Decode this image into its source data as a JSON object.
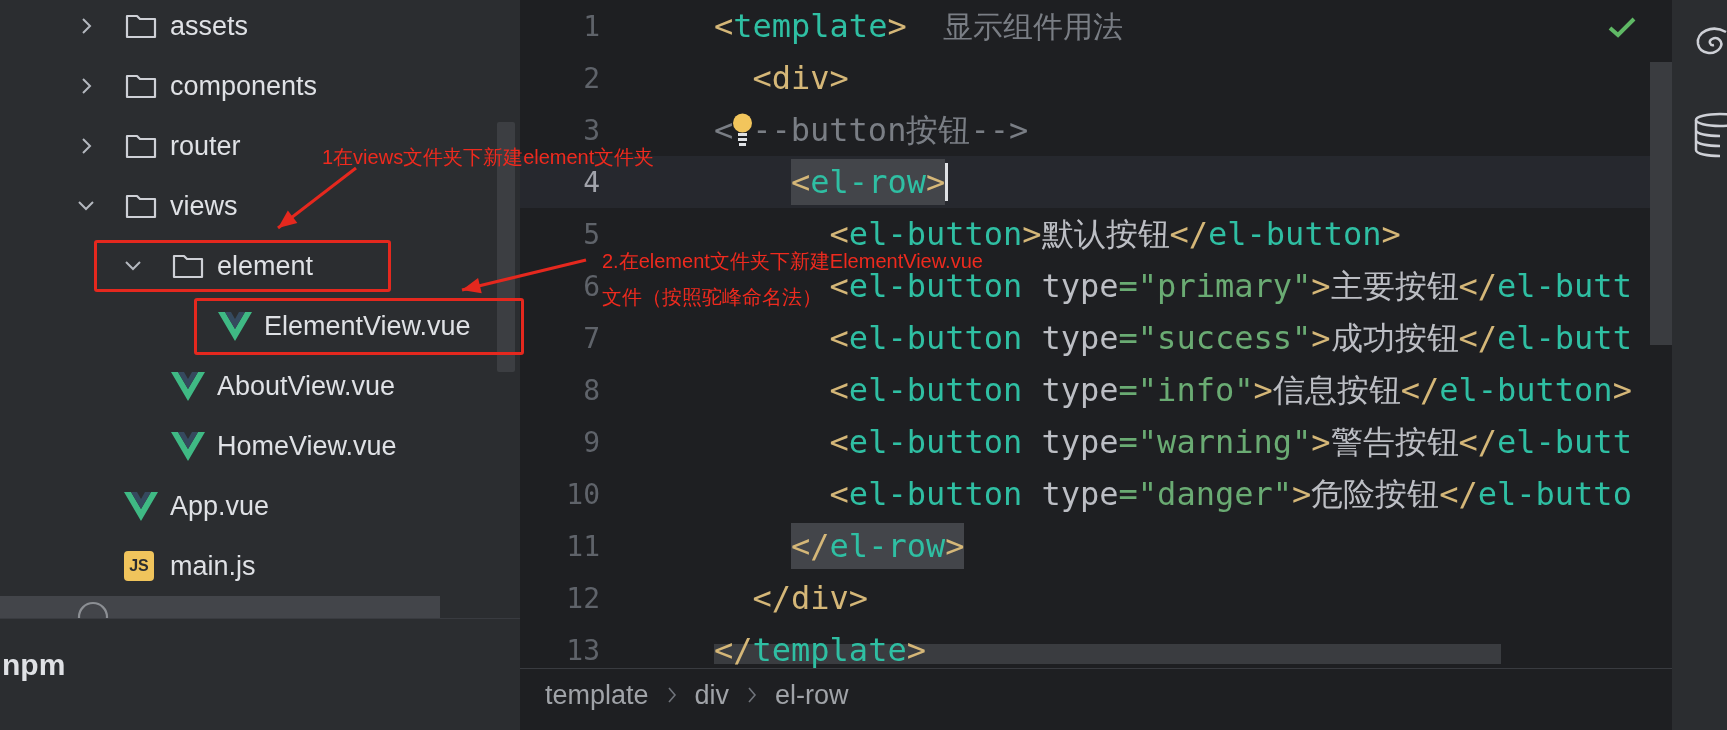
{
  "project_tree": {
    "items": [
      {
        "name": "assets",
        "kind": "folder",
        "expanded": false,
        "selected": false
      },
      {
        "name": "components",
        "kind": "folder",
        "expanded": false,
        "selected": false
      },
      {
        "name": "router",
        "kind": "folder",
        "expanded": false,
        "selected": false
      },
      {
        "name": "views",
        "kind": "folder",
        "expanded": true,
        "selected": false,
        "children": [
          {
            "name": "element",
            "kind": "folder",
            "expanded": true,
            "selected": false,
            "children": [
              {
                "name": "ElementView.vue",
                "kind": "vue",
                "selected": false
              }
            ]
          },
          {
            "name": "AboutView.vue",
            "kind": "vue",
            "selected": false
          },
          {
            "name": "HomeView.vue",
            "kind": "vue",
            "selected": false
          }
        ]
      },
      {
        "name": "App.vue",
        "kind": "vue",
        "selected": false
      },
      {
        "name": "main.js",
        "kind": "js",
        "badge": "JS",
        "selected": false
      },
      {
        "kind": "partial",
        "selected": true
      }
    ]
  },
  "bottom_panel": {
    "title": "npm"
  },
  "editor": {
    "lines": [
      {
        "number": "1",
        "current": false,
        "tokens": [
          {
            "kind": "punct",
            "text": "<"
          },
          {
            "kind": "tag",
            "text": "template"
          },
          {
            "kind": "punct",
            "text": ">"
          },
          {
            "kind": "hint",
            "text": "显示组件用法"
          }
        ]
      },
      {
        "number": "2",
        "current": false,
        "tokens": [
          {
            "kind": "punct",
            "text": "  <div>"
          }
        ]
      },
      {
        "number": "3",
        "current": false,
        "tokens": [
          {
            "kind": "comment",
            "text": "<"
          },
          {
            "kind": "bulb"
          },
          {
            "kind": "comment",
            "text": "--button按钮-->"
          }
        ]
      },
      {
        "number": "4",
        "current": true,
        "tokens": [
          {
            "kind": "punct",
            "text": "    <",
            "highlight": true
          },
          {
            "kind": "tag",
            "text": "el-row",
            "highlight": true
          },
          {
            "kind": "punct",
            "text": ">",
            "highlight": true
          },
          {
            "kind": "caret"
          }
        ]
      },
      {
        "number": "5",
        "current": false,
        "tokens": [
          {
            "kind": "punct",
            "text": "      <"
          },
          {
            "kind": "tag",
            "text": "el-button"
          },
          {
            "kind": "punct",
            "text": ">"
          },
          {
            "kind": "text",
            "text": "默认按钮"
          },
          {
            "kind": "punct",
            "text": "</"
          },
          {
            "kind": "tag",
            "text": "el-button"
          },
          {
            "kind": "punct",
            "text": ">"
          }
        ]
      },
      {
        "number": "6",
        "current": false,
        "tokens": [
          {
            "kind": "punct",
            "text": "      <"
          },
          {
            "kind": "tag",
            "text": "el-button"
          },
          {
            "kind": "attr",
            "text": " type"
          },
          {
            "kind": "string",
            "text": "=\"primary\""
          },
          {
            "kind": "punct",
            "text": ">"
          },
          {
            "kind": "text",
            "text": "主要按钮"
          },
          {
            "kind": "punct",
            "text": "</"
          },
          {
            "kind": "tag",
            "text": "el-butt"
          }
        ]
      },
      {
        "number": "7",
        "current": false,
        "tokens": [
          {
            "kind": "punct",
            "text": "      <"
          },
          {
            "kind": "tag",
            "text": "el-button"
          },
          {
            "kind": "attr",
            "text": " type"
          },
          {
            "kind": "string",
            "text": "=\"success\""
          },
          {
            "kind": "punct",
            "text": ">"
          },
          {
            "kind": "text",
            "text": "成功按钮"
          },
          {
            "kind": "punct",
            "text": "</"
          },
          {
            "kind": "tag",
            "text": "el-butt"
          }
        ]
      },
      {
        "number": "8",
        "current": false,
        "tokens": [
          {
            "kind": "punct",
            "text": "      <"
          },
          {
            "kind": "tag",
            "text": "el-button"
          },
          {
            "kind": "attr",
            "text": " type"
          },
          {
            "kind": "string",
            "text": "=\"info\""
          },
          {
            "kind": "punct",
            "text": ">"
          },
          {
            "kind": "text",
            "text": "信息按钮"
          },
          {
            "kind": "punct",
            "text": "</"
          },
          {
            "kind": "tag",
            "text": "el-button"
          },
          {
            "kind": "punct",
            "text": ">"
          }
        ]
      },
      {
        "number": "9",
        "current": false,
        "tokens": [
          {
            "kind": "punct",
            "text": "      <"
          },
          {
            "kind": "tag",
            "text": "el-button"
          },
          {
            "kind": "attr",
            "text": " type"
          },
          {
            "kind": "string",
            "text": "=\"warning\""
          },
          {
            "kind": "punct",
            "text": ">"
          },
          {
            "kind": "text",
            "text": "警告按钮"
          },
          {
            "kind": "punct",
            "text": "</"
          },
          {
            "kind": "tag",
            "text": "el-butt"
          }
        ]
      },
      {
        "number": "10",
        "current": false,
        "tokens": [
          {
            "kind": "punct",
            "text": "      <"
          },
          {
            "kind": "tag",
            "text": "el-button"
          },
          {
            "kind": "attr",
            "text": " type"
          },
          {
            "kind": "string",
            "text": "=\"danger\""
          },
          {
            "kind": "punct",
            "text": ">"
          },
          {
            "kind": "text",
            "text": "危险按钮"
          },
          {
            "kind": "punct",
            "text": "</"
          },
          {
            "kind": "tag",
            "text": "el-butto"
          }
        ]
      },
      {
        "number": "11",
        "current": false,
        "tokens": [
          {
            "kind": "punct",
            "text": "    </",
            "highlight": true
          },
          {
            "kind": "tag",
            "text": "el-row",
            "highlight": true
          },
          {
            "kind": "punct",
            "text": ">",
            "highlight": true
          }
        ]
      },
      {
        "number": "12",
        "current": false,
        "tokens": [
          {
            "kind": "punct",
            "text": "  </div>"
          }
        ]
      },
      {
        "number": "13",
        "current": false,
        "tokens": [
          {
            "kind": "punct",
            "text": "</"
          },
          {
            "kind": "tag",
            "text": "template"
          },
          {
            "kind": "punct",
            "text": ">"
          }
        ]
      }
    ]
  },
  "breadcrumb": [
    "template",
    "div",
    "el-row"
  ],
  "annotations": [
    {
      "lines": [
        "1在views文件夹下新建element文件夹"
      ]
    },
    {
      "lines": [
        "2.在element文件夹下新建ElementView.vue",
        "文件（按照驼峰命名法）"
      ]
    }
  ]
}
